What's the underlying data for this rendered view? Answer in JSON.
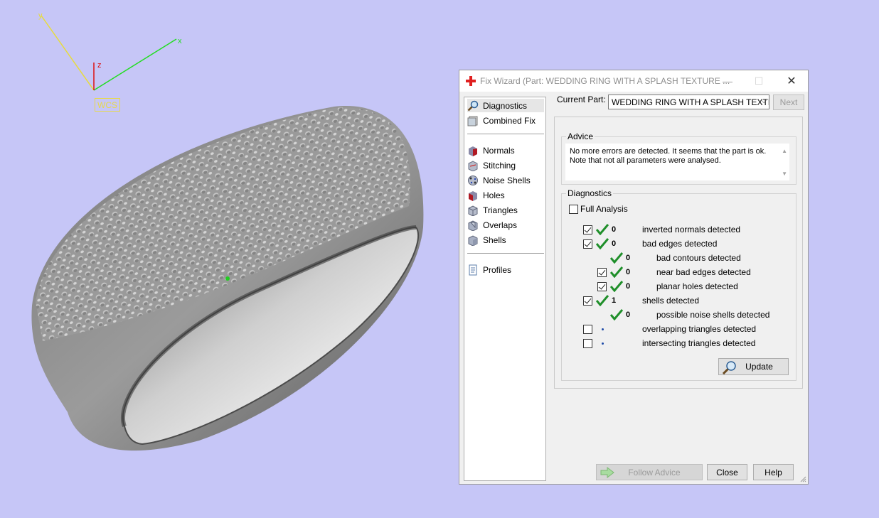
{
  "viewport": {
    "background": "#c6c6f7",
    "axes": {
      "x_label": "x",
      "y_label": "y",
      "z_label": "z",
      "wcs_label": "WCS"
    }
  },
  "dialog": {
    "title": "Fix Wizard (Part: WEDDING RING WITH A SPLASH TEXTURE ...",
    "window_buttons": {
      "minimize": "—",
      "maximize": "☐",
      "close": "✕"
    },
    "sidebar": {
      "top_items": [
        {
          "label": "Diagnostics",
          "icon": "magnifier-icon",
          "selected": true
        },
        {
          "label": "Combined Fix",
          "icon": "combined-fix-icon",
          "selected": false
        }
      ],
      "fix_items": [
        {
          "label": "Normals",
          "icon": "normals-icon"
        },
        {
          "label": "Stitching",
          "icon": "stitching-icon"
        },
        {
          "label": "Noise Shells",
          "icon": "noise-shells-icon"
        },
        {
          "label": "Holes",
          "icon": "holes-icon"
        },
        {
          "label": "Triangles",
          "icon": "triangles-icon"
        },
        {
          "label": "Overlaps",
          "icon": "overlaps-icon"
        },
        {
          "label": "Shells",
          "icon": "shells-icon"
        }
      ],
      "bottom_items": [
        {
          "label": "Profiles",
          "icon": "profiles-icon"
        }
      ]
    },
    "current_part": {
      "label": "Current Part:",
      "value": "WEDDING RING WITH A SPLASH TEXTI",
      "next_label": "Next"
    },
    "advice": {
      "title": "Advice",
      "line1": "No more errors are detected. It seems that the part is ok.",
      "line2": "Note that not all parameters were analysed."
    },
    "diagnostics": {
      "title": "Diagnostics",
      "full_analysis_label": "Full Analysis",
      "full_analysis_checked": false,
      "rows": [
        {
          "label": "inverted normals detected",
          "count": "0",
          "checked": true,
          "status": "ok"
        },
        {
          "label": "bad edges detected",
          "count": "0",
          "checked": true,
          "status": "ok"
        },
        {
          "label": "bad contours detected",
          "count": "0",
          "status": "ok"
        },
        {
          "label": "near bad edges detected",
          "count": "0",
          "checked": true,
          "status": "ok"
        },
        {
          "label": "planar holes detected",
          "count": "0",
          "checked": true,
          "status": "ok"
        },
        {
          "label": "shells detected",
          "count": "1",
          "checked": true,
          "status": "ok"
        },
        {
          "label": "possible noise shells detected",
          "count": "0",
          "status": "ok"
        },
        {
          "label": "overlapping triangles detected",
          "count": "",
          "checked": false,
          "status": "not-analysed"
        },
        {
          "label": "intersecting triangles detected",
          "count": "",
          "checked": false,
          "status": "not-analysed"
        }
      ],
      "update_label": "Update"
    },
    "buttons": {
      "follow_advice": "Follow Advice",
      "close": "Close",
      "help": "Help"
    }
  }
}
